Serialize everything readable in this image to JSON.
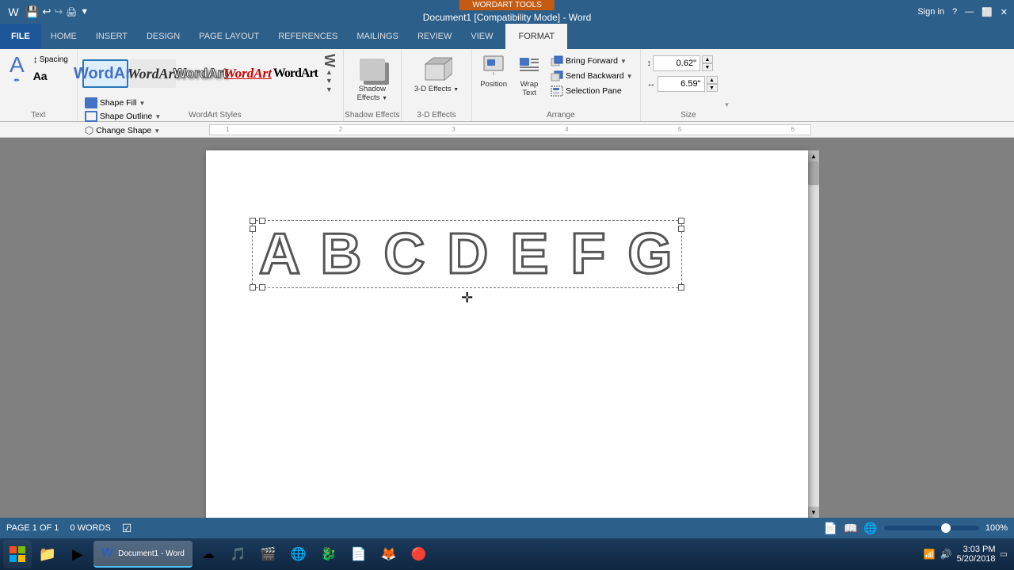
{
  "titlebar": {
    "title": "Document1 [Compatibility Mode] - Word",
    "wordart_tools": "WORDART TOOLS",
    "sign_in": "Sign in"
  },
  "quickaccess": {
    "buttons": [
      "💾",
      "↩",
      "↪",
      "▶"
    ]
  },
  "tabs": {
    "items": [
      "FILE",
      "HOME",
      "INSERT",
      "DESIGN",
      "PAGE LAYOUT",
      "REFERENCES",
      "MAILINGS",
      "REVIEW",
      "VIEW"
    ],
    "active": "FORMAT",
    "format": "FORMAT"
  },
  "ribbon": {
    "text_group": {
      "label": "Text",
      "edit_text": "Edit\nText",
      "spacing": "Spacing",
      "aa_label": "Aa"
    },
    "wordart_styles": {
      "label": "WordArt Styles",
      "styles": [
        "WordArt",
        "WordArt",
        "WordArt",
        "WordArt",
        "WordArt"
      ]
    },
    "shape_fill": "Shape Fill",
    "shape_outline": "Shape Outline",
    "change_shape": "Change Shape",
    "shadow_effects": {
      "label": "Shadow Effects",
      "group_label": "Shadow Effects"
    },
    "threed_effects": {
      "label": "3-D Effects",
      "group_label": "3-D Effects"
    },
    "position": "Position",
    "wrap_text": "Wrap\nText",
    "bring_forward": "Bring Forward",
    "send_backward": "Send Backward",
    "selection_pane": "Selection Pane",
    "arrange_label": "Arrange",
    "size": {
      "label": "Size",
      "height": "0.62\"",
      "width": "6.59\""
    }
  },
  "document": {
    "wordart_text": "A B C D E F G"
  },
  "statusbar": {
    "page": "PAGE 1 OF 1",
    "words": "0 WORDS",
    "zoom": "100%"
  },
  "taskbar": {
    "time": "3:03 PM",
    "date": "5/20/2018",
    "apps": [
      "⊞",
      "📁",
      "▶",
      "W",
      "☁",
      "🎵",
      "🎬",
      "🌐",
      "🐉",
      "📄",
      "🦊",
      "🔴"
    ]
  }
}
